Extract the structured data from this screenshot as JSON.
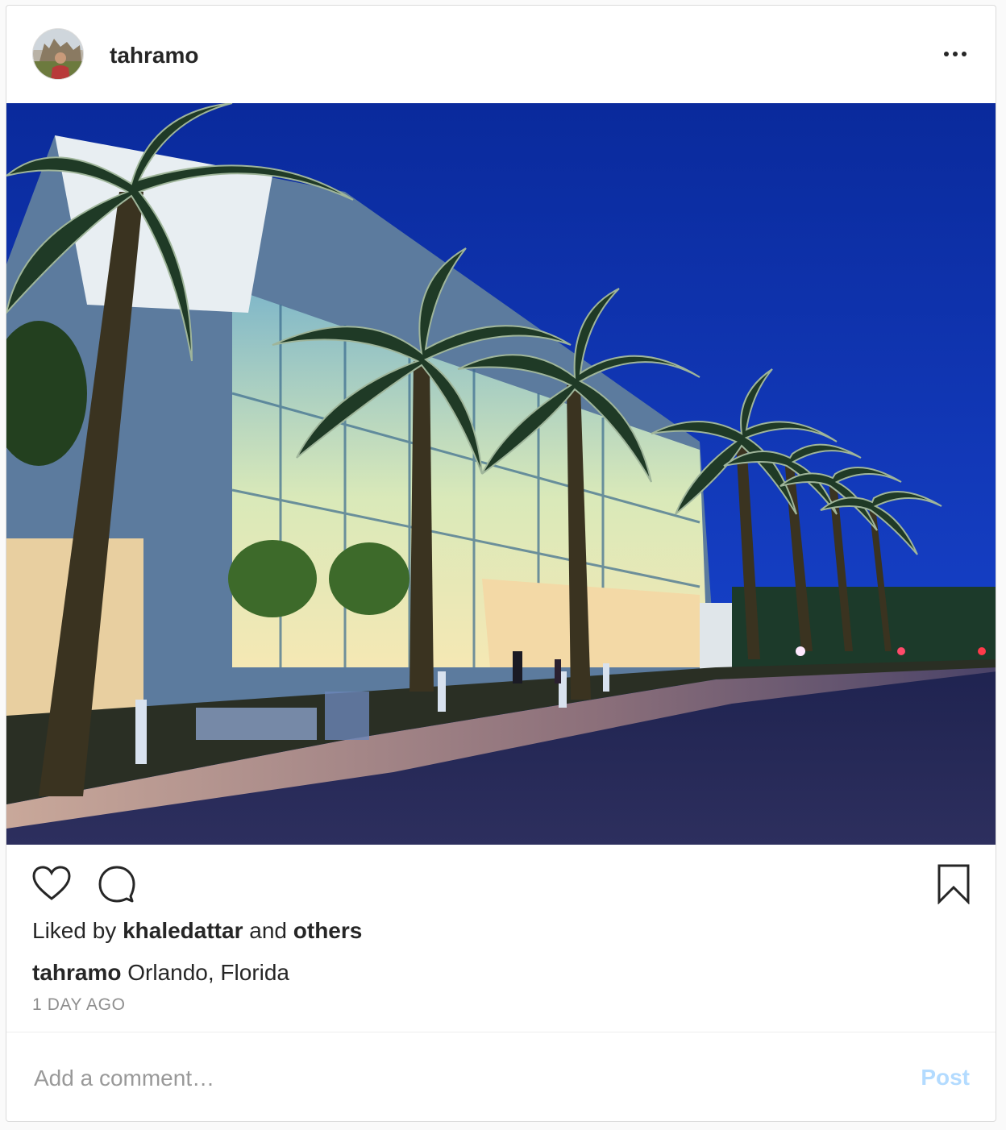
{
  "post": {
    "username": "tahramo",
    "liked_by_prefix": "Liked by",
    "liked_by_user": "khaledattar",
    "liked_by_and": "and",
    "liked_by_others": "others",
    "caption_user": "tahramo",
    "caption_text": "Orlando, Florida",
    "timestamp": "1 DAY AGO"
  },
  "comment": {
    "placeholder": "Add a comment…",
    "post_label": "Post"
  },
  "colors": {
    "post_disabled": "#b3dbff",
    "sky": "#0b2fa8",
    "muted_text": "#8e8e8e"
  },
  "icons": [
    "more-icon",
    "heart-icon",
    "comment-icon",
    "bookmark-icon"
  ]
}
